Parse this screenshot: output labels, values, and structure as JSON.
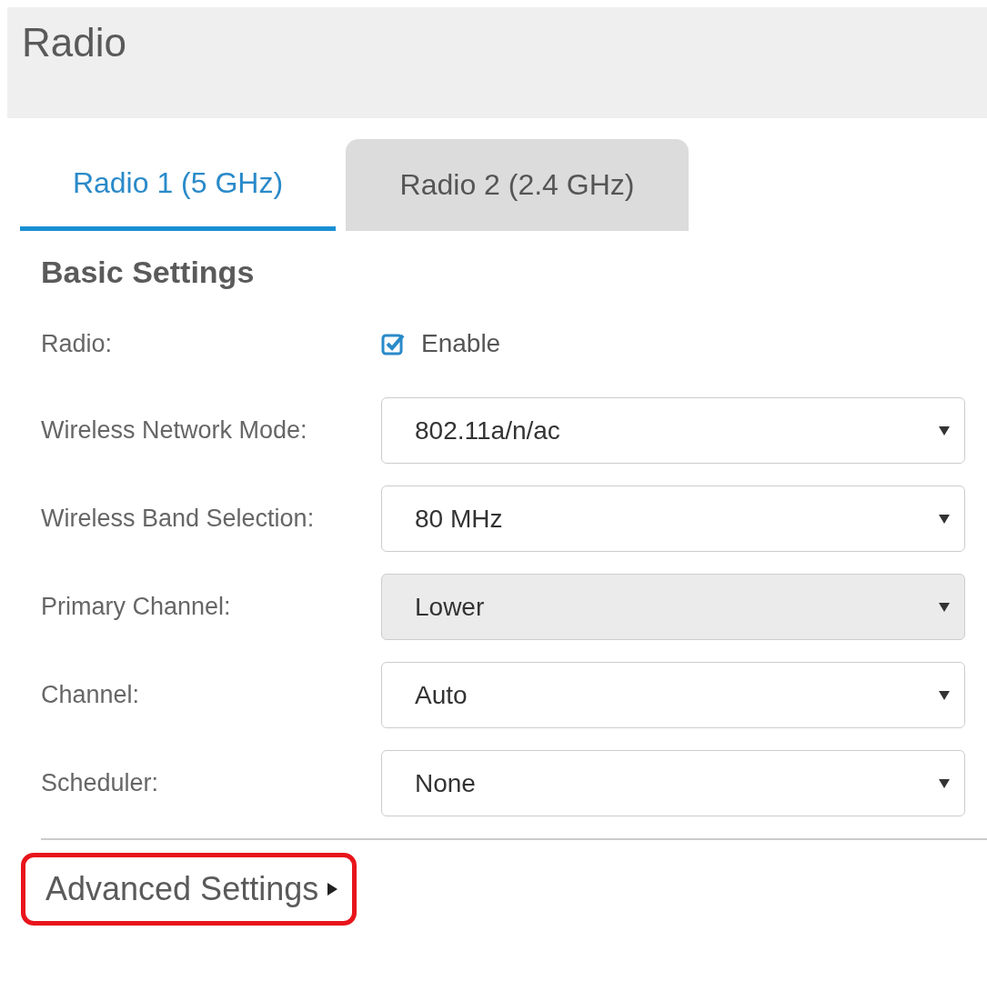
{
  "page_title": "Radio",
  "tabs": [
    {
      "label": "Radio 1 (5 GHz)",
      "selected": true
    },
    {
      "label": "Radio 2 (2.4 GHz)",
      "selected": false
    }
  ],
  "section_title": "Basic Settings",
  "fields": [
    {
      "kind": "checkbox",
      "label": "Radio:",
      "option": "Enable",
      "checked": true
    },
    {
      "kind": "select",
      "label": "Wireless Network Mode:",
      "value": "802.11a/n/ac",
      "disabled": false
    },
    {
      "kind": "select",
      "label": "Wireless Band Selection:",
      "value": "80 MHz",
      "disabled": false
    },
    {
      "kind": "select",
      "label": "Primary Channel:",
      "value": "Lower",
      "disabled": true
    },
    {
      "kind": "select",
      "label": "Channel:",
      "value": "Auto",
      "disabled": false
    },
    {
      "kind": "select",
      "label": "Scheduler:",
      "value": "None",
      "disabled": false
    }
  ],
  "advanced": {
    "label": "Advanced Settings",
    "expanded": false,
    "highlighted": true
  }
}
